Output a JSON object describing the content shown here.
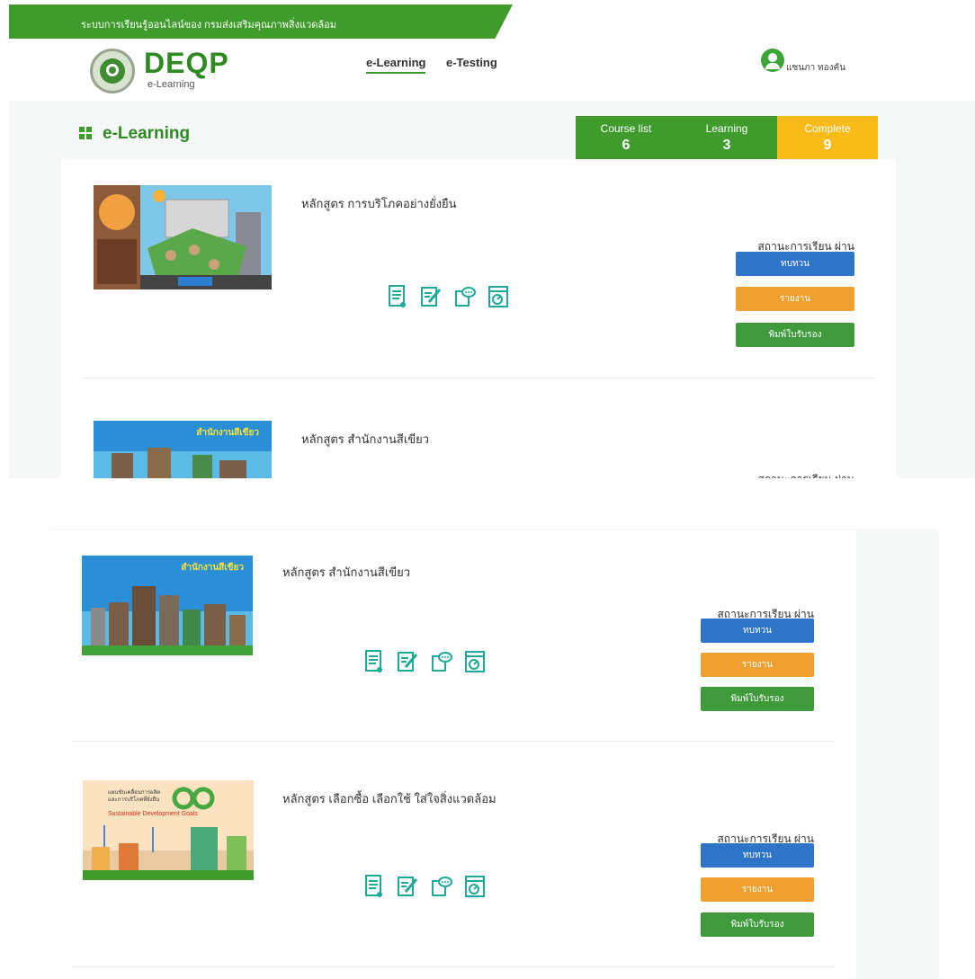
{
  "topbar": {
    "text": "ระบบการเรียนรู้ออนไลน์ของ กรมส่งเสริมคุณภาพสิ่งแวดล้อม"
  },
  "logo": {
    "brand": "DEQP",
    "sub": "e-Learning"
  },
  "nav": {
    "elearning": "e-Learning",
    "etesting": "e-Testing"
  },
  "user": {
    "name": "แซนภา ทองคัน"
  },
  "section": {
    "title": "e-Learning"
  },
  "stats": [
    {
      "label": "Course list",
      "value": "6",
      "color": "#3f9b2c"
    },
    {
      "label": "Learning",
      "value": "3",
      "color": "#3f9b2c"
    },
    {
      "label": "Complete",
      "value": "9",
      "color": "#f9bb1a"
    }
  ],
  "courses_top": [
    {
      "title": "หลักสูตร การบริโภคอย่างยั่งยืน",
      "status": "สถานะการเรียน ผ่าน",
      "review": "ทบทวน",
      "report": "รายงาน",
      "print": "พิมพ์ใบรับรอง"
    },
    {
      "title": "หลักสูตร สำนักงานสีเขียว",
      "status": "สถานะการเรียน ผ่าน"
    }
  ],
  "courses_bottom": [
    {
      "title": "หลักสูตร สำนักงานสีเขียว",
      "status": "สถานะการเรียน ผ่าน",
      "review": "ทบทวน",
      "report": "รายงาน",
      "print": "พิมพ์ใบรับรอง",
      "banner": "สำนักงานสีเขียว"
    },
    {
      "title": "หลักสูตร เลือกซื้อ เลือกใช้ ใส่ใจสิ่งแวดล้อม",
      "status": "สถานะการเรียน ผ่าน",
      "review": "ทบทวน",
      "report": "รายงาน",
      "print": "พิมพ์ใบรับรอง",
      "banner1": "แผนขับเคลื่อนการผลิต",
      "banner2": "และการบริโภคที่ยั่งยืน",
      "banner3": "Sustainable Development Goals"
    }
  ],
  "thumb_top": {
    "banner": "สำนักงานสีเขียว"
  },
  "colors": {
    "primary_green": "#3f9b2c",
    "accent_yellow": "#f9bb1a",
    "blue": "#2e75c9",
    "orange": "#f0a030",
    "icon_teal": "#1fa99a"
  },
  "icons": [
    "document-icon",
    "edit-icon",
    "chat-icon",
    "chart-icon"
  ]
}
